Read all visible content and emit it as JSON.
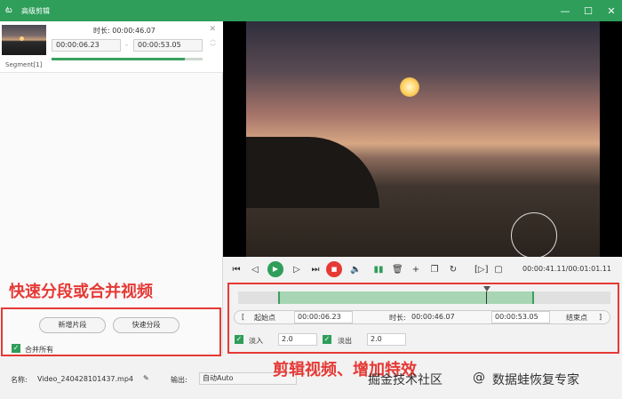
{
  "window": {
    "title": "高级剪辑"
  },
  "segment": {
    "label": "Segment[1]",
    "duration": "时长:  00:00:46.07",
    "start": "00:00:06.23",
    "end": "00:00:53.05",
    "sep": "-"
  },
  "annotations": {
    "left": "快速分段或合并视频",
    "right": "剪辑视频、增加特效"
  },
  "left_actions": {
    "add_segment": "新增片段",
    "quick_split": "快速分段",
    "merge_all": "合并所有"
  },
  "player": {
    "timecode": "00:00:41.11/00:01:01.11"
  },
  "trim": {
    "start_label": "起始点",
    "start_value": "00:00:06.23",
    "duration_label": "时长:",
    "duration_value": "00:00:46.07",
    "end_value": "00:00:53.05",
    "end_label": "结束点",
    "bracket_open": "[",
    "bracket_close": "]"
  },
  "effects": {
    "fade_in_label": "淡入",
    "fade_in_value": "2.0",
    "fade_out_label": "淡出",
    "fade_out_value": "2.0"
  },
  "footer": {
    "name_label": "名称:",
    "file_name": "Video_240428101437.mp4",
    "output_label": "输出:",
    "output_value": "自动Auto"
  },
  "watermark": {
    "community": "掘金技术社区",
    "at": "@",
    "brand": "数据蛙恢复专家"
  },
  "colors": {
    "accent": "#2e9e5a",
    "annotation": "#e53935",
    "stop": "#e53935"
  }
}
